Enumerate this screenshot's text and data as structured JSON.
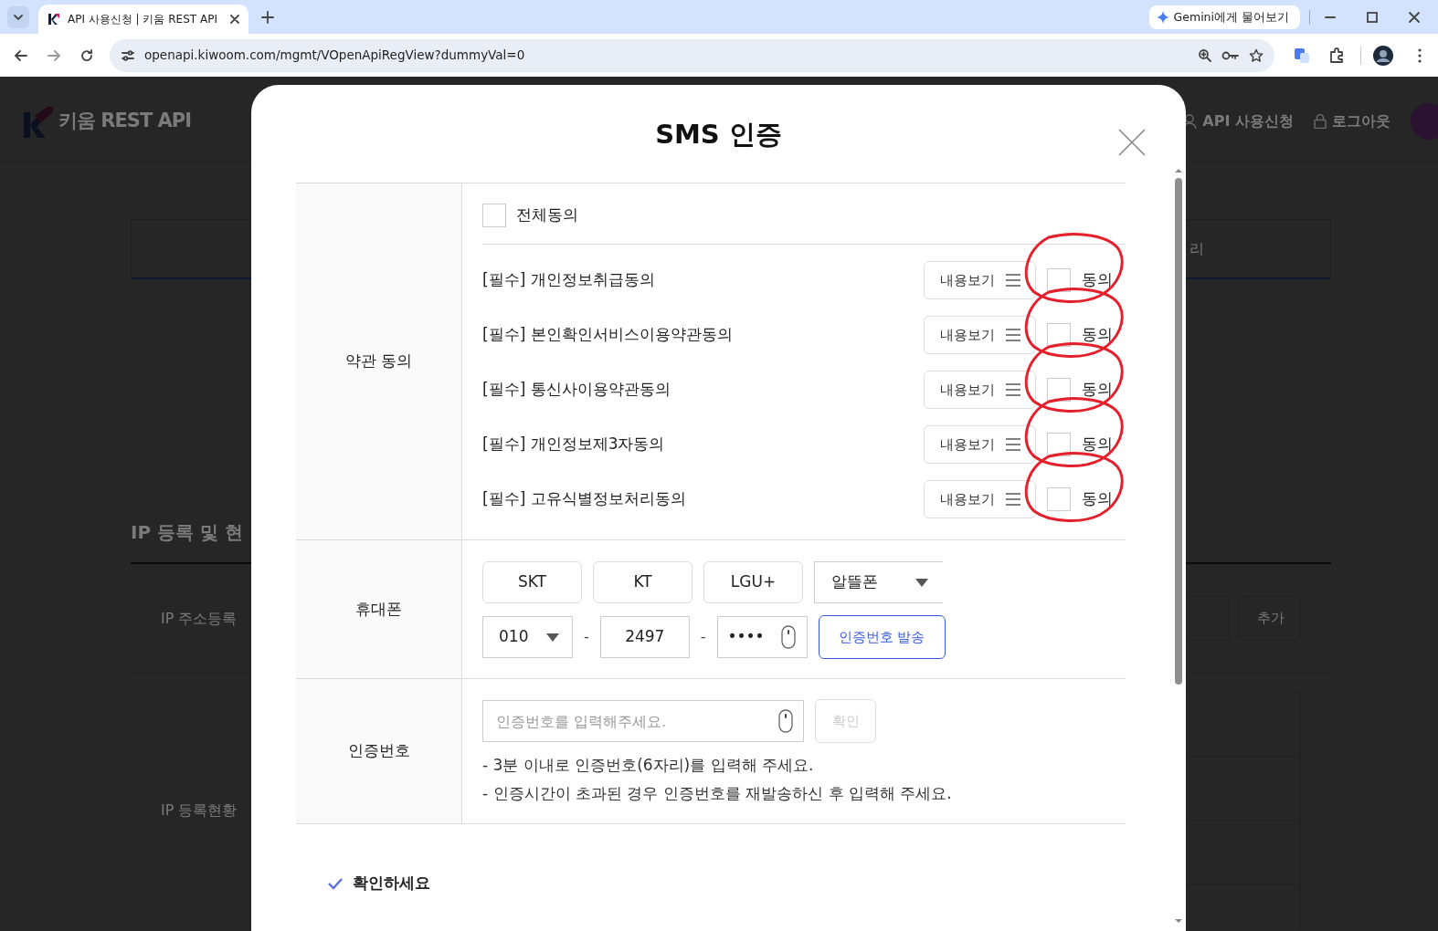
{
  "browser": {
    "tab_title": "API 사용신청 | 키움 REST API",
    "url": "openapi.kiwoom.com/mgmt/VOpenApiRegView?dummyVal=0",
    "gemini_button": "Gemini에게 물어보기"
  },
  "page": {
    "logo": "키움 REST API",
    "nav": [
      {
        "label": "API 사용신청",
        "kind": "user"
      },
      {
        "label": "로그아웃",
        "kind": "lock"
      }
    ],
    "tab_fragment": "리",
    "section_title": "IP 등록 및 현",
    "register_label": "IP 주소등록",
    "add_button": "추가",
    "status_label": "IP 등록현황"
  },
  "modal": {
    "title": "SMS 인증",
    "terms": {
      "label": "약관 동의",
      "all": {
        "label": "전체동의",
        "checked": false
      },
      "items": [
        {
          "label": "[필수] 개인정보취급동의",
          "view_button": "내용보기",
          "agree_label": "동의",
          "checked": false,
          "circled": true
        },
        {
          "label": "[필수] 본인확인서비스이용약관동의",
          "view_button": "내용보기",
          "agree_label": "동의",
          "checked": false,
          "circled": true
        },
        {
          "label": "[필수] 통신사이용약관동의",
          "view_button": "내용보기",
          "agree_label": "동의",
          "checked": false,
          "circled": true
        },
        {
          "label": "[필수] 개인정보제3자동의",
          "view_button": "내용보기",
          "agree_label": "동의",
          "checked": false,
          "circled": true
        },
        {
          "label": "[필수] 고유식별정보처리동의",
          "view_button": "내용보기",
          "agree_label": "동의",
          "checked": false,
          "circled": true
        }
      ]
    },
    "phone": {
      "label": "휴대폰",
      "carriers": [
        {
          "label": "SKT",
          "kind": "button",
          "selected": false
        },
        {
          "label": "KT",
          "kind": "button",
          "selected": false
        },
        {
          "label": "LGU+",
          "kind": "button",
          "selected": false
        },
        {
          "label": "알뜰폰",
          "kind": "select",
          "selected": false
        }
      ],
      "number": [
        {
          "kind": "select",
          "value": "010"
        },
        {
          "kind": "input",
          "value": "2497"
        },
        {
          "kind": "secure",
          "value": "••••"
        }
      ],
      "separators": [
        "-",
        "-"
      ],
      "send_button": "인증번호 발송"
    },
    "auth": {
      "label": "인증번호",
      "placeholder": "인증번호를 입력해주세요.",
      "confirm": {
        "label": "확인",
        "disabled": true
      },
      "notes": [
        "- 3분 이내로 인증번호(6자리)를 입력해 주세요.",
        "- 인증시간이 초과된 경우 인증번호를 재발송하신 후 입력해 주세요."
      ]
    },
    "footer": "확인하세요"
  }
}
